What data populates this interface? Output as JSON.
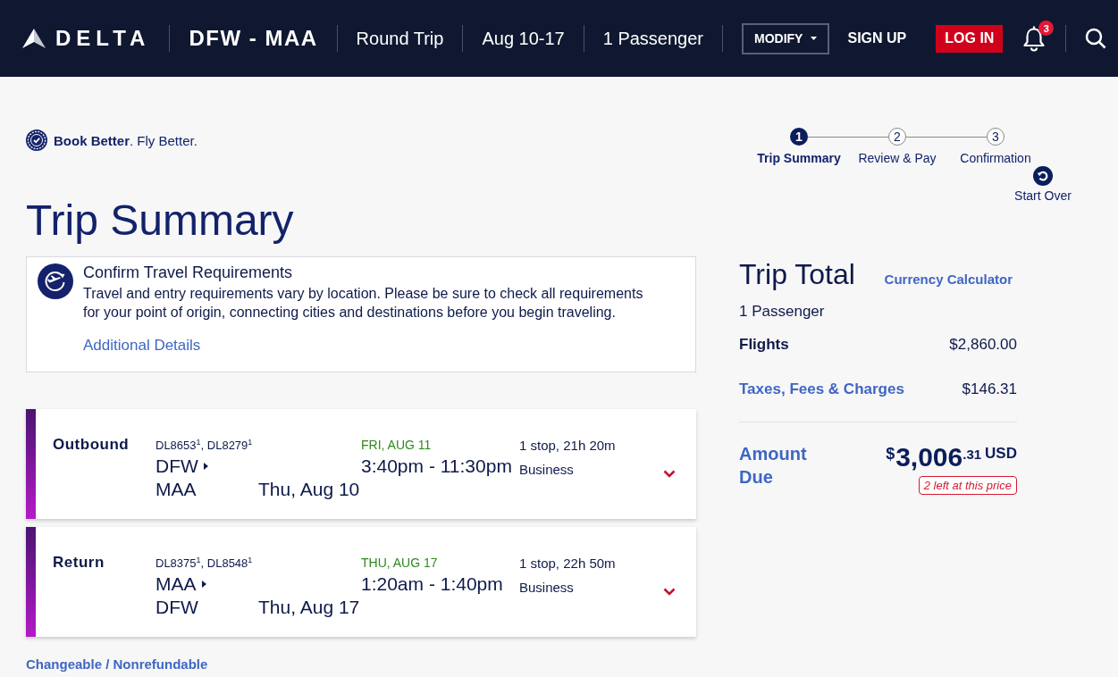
{
  "header": {
    "logo": "DELTA",
    "route": "DFW - MAA",
    "trip_type": "Round Trip",
    "dates": "Aug 10-17",
    "passengers": "1 Passenger",
    "modify_button": "MODIFY",
    "sign_up": "SIGN UP",
    "log_in": "LOG IN",
    "notification_count": "3"
  },
  "tagline": "**Book Better**. Fly Better.",
  "steps": [
    {
      "number": "1",
      "label": "Trip Summary",
      "selected": true
    },
    {
      "number": "2",
      "label": "Review & Pay",
      "selected": false
    },
    {
      "number": "3",
      "label": "Confirmation",
      "selected": false
    }
  ],
  "start_over": "Start Over",
  "page_title": "Trip Summary",
  "travel_notice": {
    "title": "Confirm Travel Requirements",
    "body": "Travel and entry requirements vary by location. Please be sure to check all requirements for your point of origin, connecting cities and destinations before you begin traveling.",
    "link": "Additional Details"
  },
  "flights": [
    {
      "label": "Outbound",
      "flight_numbers": "DL8653$^{1}$, DL8279$^{1}$",
      "origin": "DFW",
      "destination": "MAA",
      "departure_date": "Thu, Aug 10",
      "arrival_date": "FRI, AUG 11",
      "times": "3:40pm - 11:30pm",
      "stops": "1 stop, 21h 20m",
      "cabin": "Business"
    },
    {
      "label": "Return",
      "flight_numbers": "DL8375$^{1}$, DL8548$^{1}$",
      "origin": "MAA",
      "destination": "DFW",
      "departure_date": "Thu, Aug 17",
      "arrival_date": "THU, AUG 17",
      "times": "1:20am - 1:40pm",
      "stops": "1 stop, 22h 50m",
      "cabin": "Business"
    }
  ],
  "fare_rules_link": "Changeable / Nonrefundable",
  "trip_total": {
    "title": "Trip Total",
    "currency_link": "Currency Calculator",
    "passengers": "1 Passenger",
    "lines": [
      {
        "kind": "plain",
        "label": "Flights",
        "amount": "$2,860.00"
      },
      {
        "kind": "link",
        "label": "Taxes, Fees & Charges",
        "amount": "$146.31"
      }
    ],
    "amount_due": {
      "label": "Amount Due",
      "currency_symbol": "$",
      "whole": "3,006",
      "cents": ".31",
      "currency": "USD"
    },
    "availability_badge": "2 left at this price"
  }
}
